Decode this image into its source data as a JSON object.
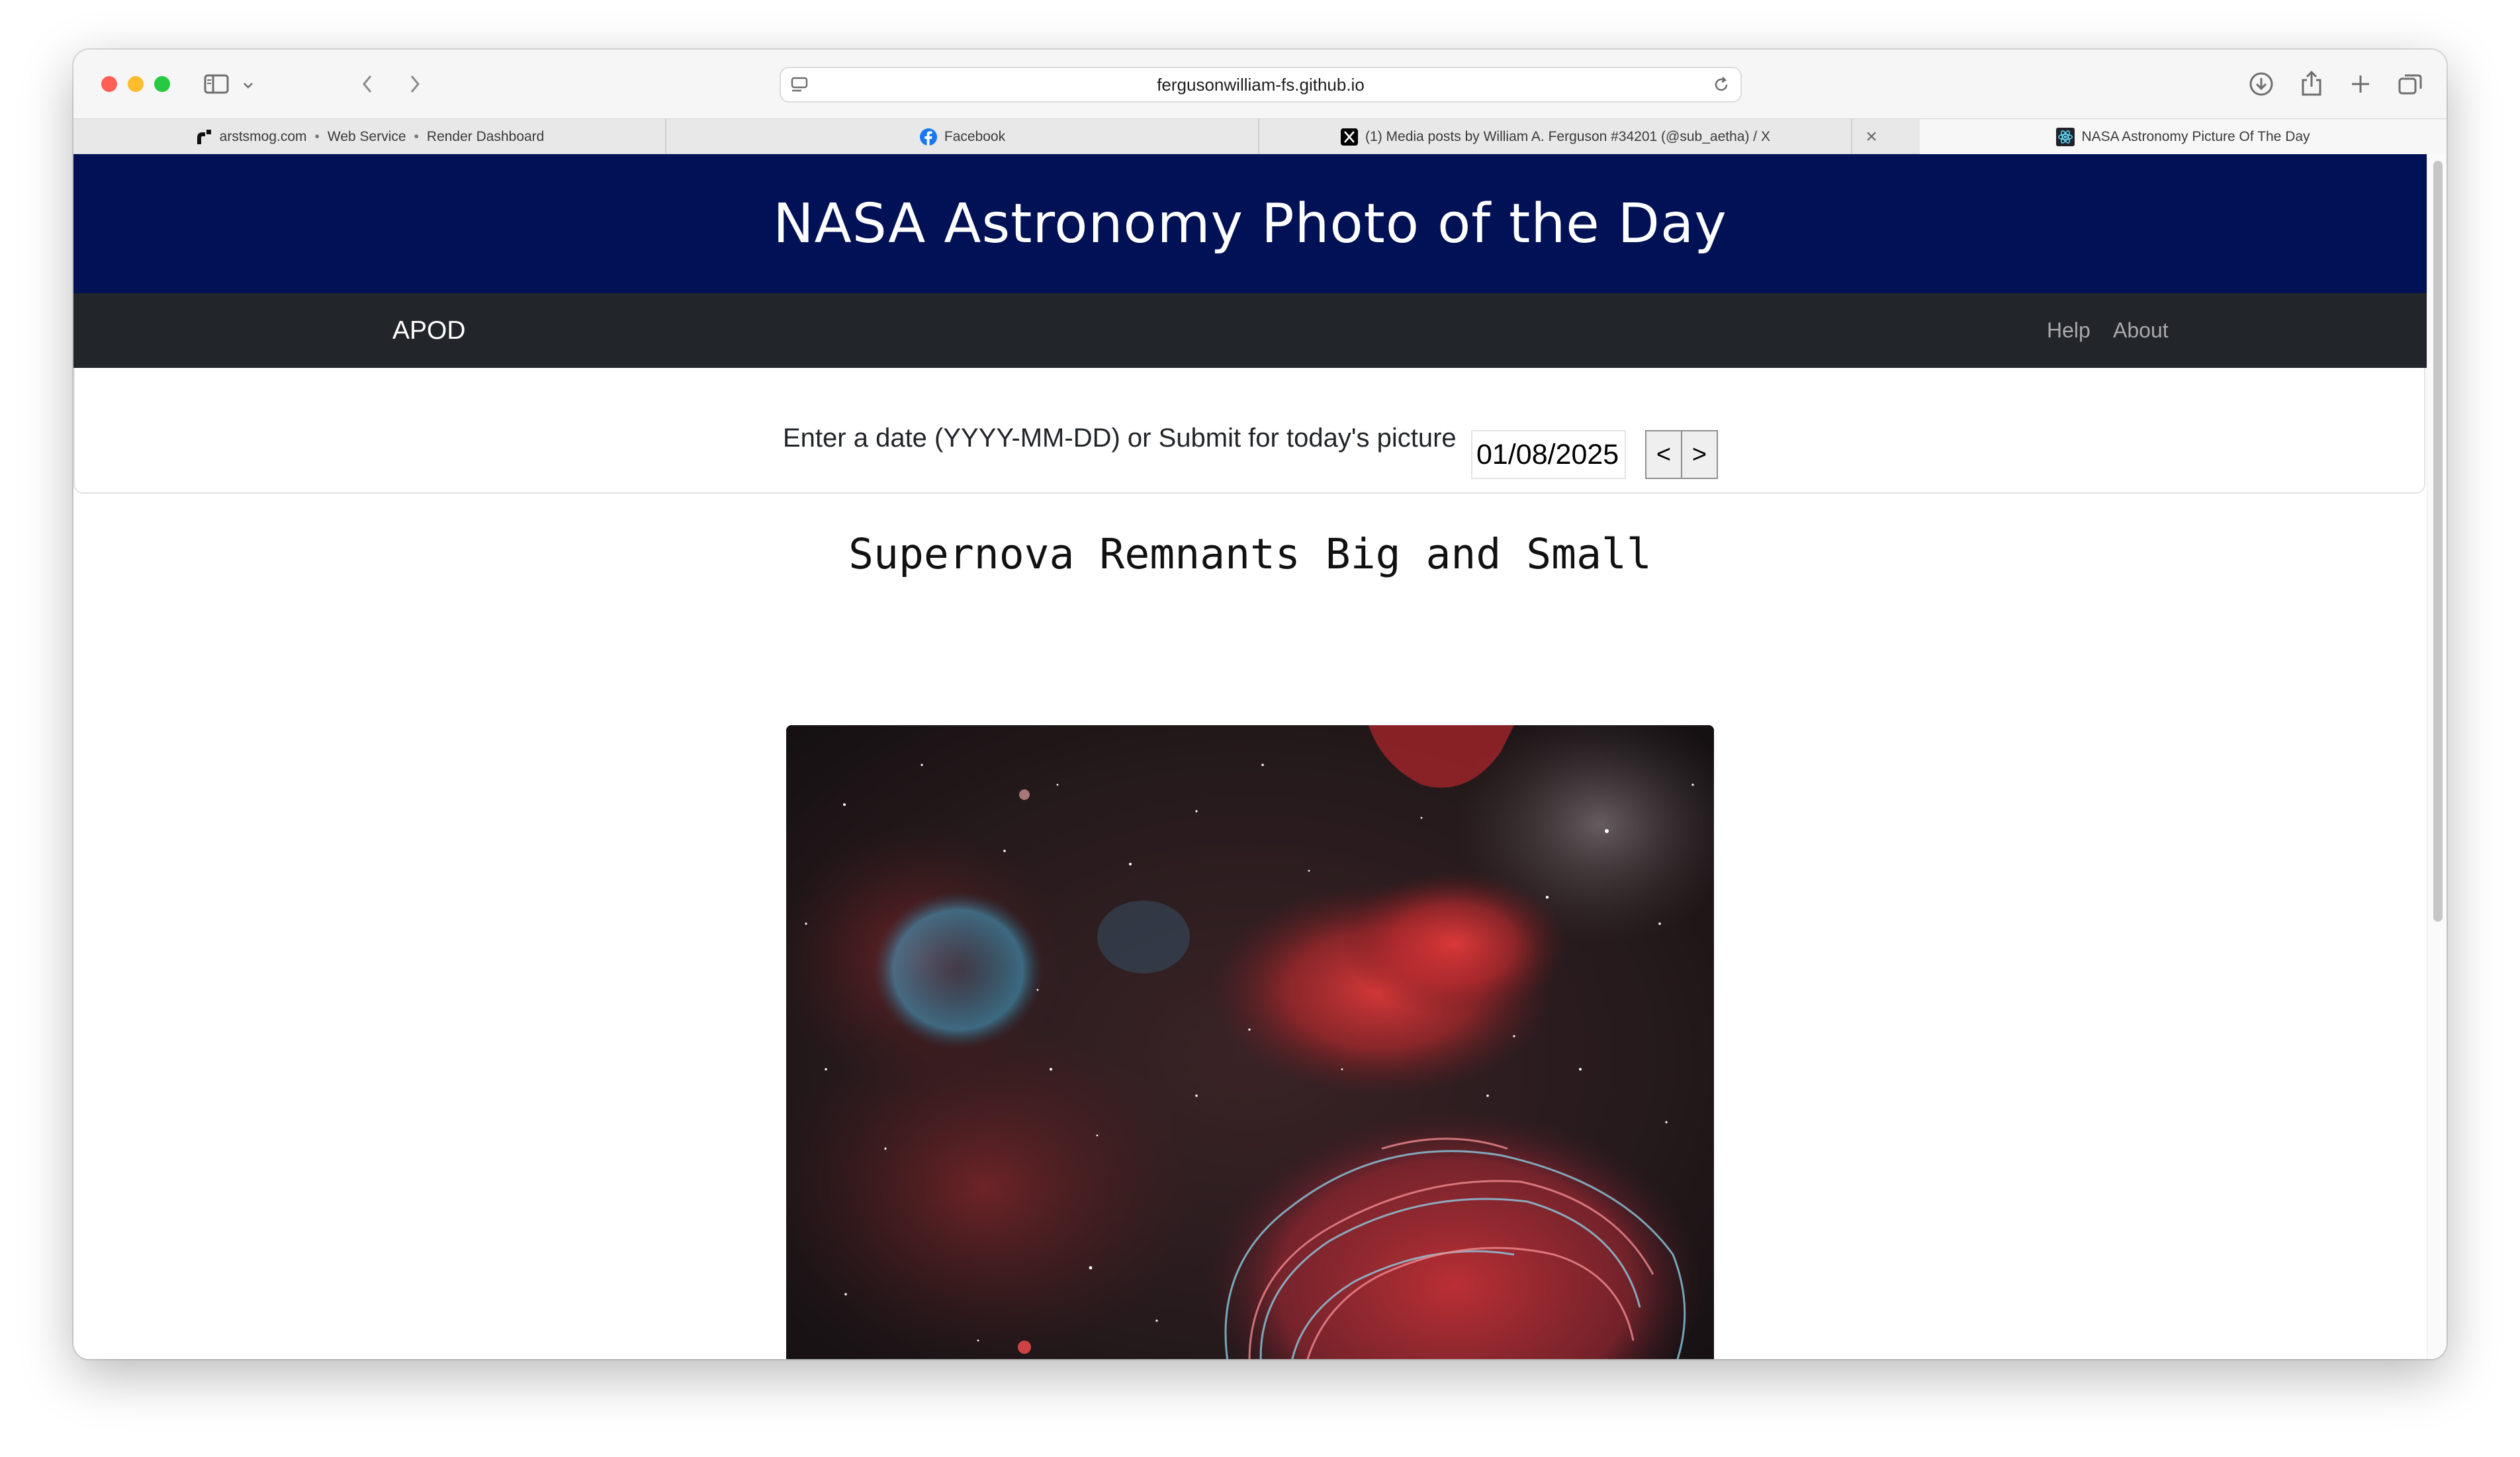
{
  "browser": {
    "url": "fergusonwilliam-fs.github.io",
    "tabs": [
      {
        "parts": [
          "arstsmog.com",
          "Web Service",
          "Render Dashboard"
        ],
        "favicon": "render-icon"
      },
      {
        "label": "Facebook",
        "favicon": "facebook-icon"
      },
      {
        "label": "(1) Media posts by William A. Ferguson #34201 (@sub_aetha) / X",
        "favicon": "x-icon"
      },
      {
        "label": "NASA Astronomy Picture Of The Day",
        "favicon": "react-icon",
        "active": true
      }
    ]
  },
  "header": {
    "title": "NASA Astronomy Photo of the Day"
  },
  "nav": {
    "brand": "APOD",
    "links": [
      "Help",
      "About"
    ]
  },
  "form": {
    "prompt": "Enter a date (YYYY-MM-DD) or Submit for today's picture",
    "date_value": "01/08/2025",
    "prev_label": "<",
    "next_label": ">"
  },
  "photo": {
    "title": "Supernova Remnants Big and Small"
  },
  "colors": {
    "banner": "#001155",
    "navbar": "#222529",
    "brand_text": "#ffffff",
    "nav_link": "#a7a9ac"
  }
}
